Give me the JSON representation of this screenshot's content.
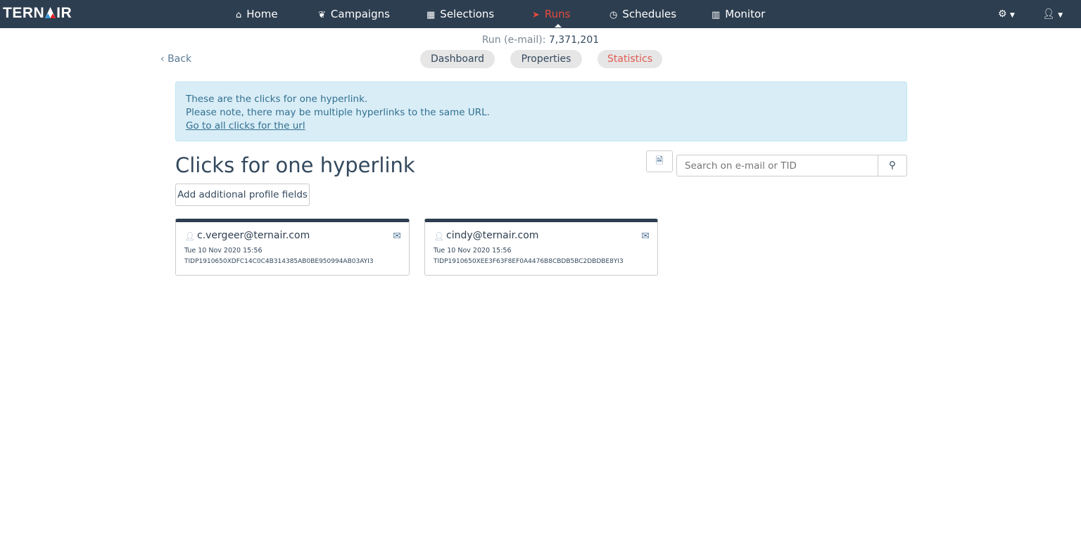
{
  "nav": {
    "logo": "TERNAIR",
    "items": [
      {
        "label": "Home",
        "icon": "home-icon"
      },
      {
        "label": "Campaigns",
        "icon": "leaf-icon"
      },
      {
        "label": "Selections",
        "icon": "cubes-icon"
      },
      {
        "label": "Runs",
        "icon": "paper-plane-icon"
      },
      {
        "label": "Schedules",
        "icon": "clock-icon"
      },
      {
        "label": "Monitor",
        "icon": "bar-chart-icon"
      }
    ]
  },
  "run": {
    "label": "Run (e-mail):",
    "number": "7,371,201"
  },
  "back": "Back",
  "tabs": [
    "Dashboard",
    "Properties",
    "Statistics"
  ],
  "alert": {
    "line1": "These are the clicks for one hyperlink.",
    "line2": "Please note, there may be multiple hyperlinks to the same URL.",
    "link": "Go to all clicks for the url"
  },
  "title": "Clicks for one hyperlink",
  "add_fields": "Add additional profile fields",
  "search": {
    "placeholder": "Search on e-mail or TID",
    "value": ""
  },
  "cards": [
    {
      "email": "c.vergeer@ternair.com",
      "date": "Tue 10 Nov 2020 15:56",
      "tid": "TIDP1910650XDFC14C0C4B314385AB0BE950994AB03AYI3"
    },
    {
      "email": "cindy@ternair.com",
      "date": "Tue 10 Nov 2020 15:56",
      "tid": "TIDP1910650XEE3F63F8EF0A4476B8CBDB5BC2DBDBE8YI3"
    }
  ]
}
